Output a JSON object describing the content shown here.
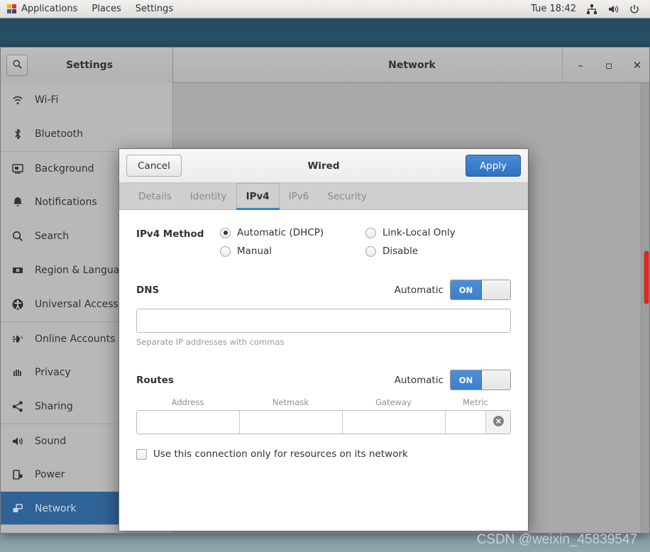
{
  "top_panel": {
    "applications_label": "Applications",
    "places_label": "Places",
    "settings_label": "Settings",
    "apps_icon": "applications-icon",
    "clock": "Tue 18:42",
    "network_icon": "network-wired-icon",
    "volume_icon": "volume-icon",
    "power_icon": "power-icon"
  },
  "window": {
    "settings_title": "Settings",
    "title": "Network",
    "search_icon": "search-icon",
    "minimize_label": "–",
    "maximize_label": "▫",
    "close_label": "✕"
  },
  "sidebar": {
    "items": [
      {
        "label": "Wi-Fi",
        "icon": "wifi-icon"
      },
      {
        "label": "Bluetooth",
        "icon": "bluetooth-icon"
      },
      {
        "label": "Background",
        "icon": "background-monitor-icon"
      },
      {
        "label": "Notifications",
        "icon": "bell-icon"
      },
      {
        "label": "Search",
        "icon": "search-icon"
      },
      {
        "label": "Region & Language",
        "icon": "region-language-icon"
      },
      {
        "label": "Universal Access",
        "icon": "universal-access-icon"
      },
      {
        "label": "Online Accounts",
        "icon": "online-accounts-icon"
      },
      {
        "label": "Privacy",
        "icon": "privacy-icon"
      },
      {
        "label": "Sharing",
        "icon": "sharing-icon"
      },
      {
        "label": "Sound",
        "icon": "sound-icon"
      },
      {
        "label": "Power",
        "icon": "power-battery-icon"
      },
      {
        "label": "Network",
        "icon": "network-icon"
      }
    ],
    "active_label": "Network"
  },
  "main_pane": {
    "add_button_label": "+",
    "gear_icon": "gear-icon",
    "scrollbar_color": "#e8231f"
  },
  "dialog": {
    "cancel_label": "Cancel",
    "title": "Wired",
    "apply_label": "Apply",
    "tabs": [
      {
        "label": "Details",
        "active": false
      },
      {
        "label": "Identity",
        "active": false
      },
      {
        "label": "IPv4",
        "active": true
      },
      {
        "label": "IPv6",
        "active": false
      },
      {
        "label": "Security",
        "active": false
      }
    ],
    "method": {
      "label": "IPv4 Method",
      "options": [
        {
          "label": "Automatic (DHCP)",
          "checked": true
        },
        {
          "label": "Link-Local Only",
          "checked": false
        },
        {
          "label": "Manual",
          "checked": false
        },
        {
          "label": "Disable",
          "checked": false
        }
      ]
    },
    "dns": {
      "label": "DNS",
      "automatic_label": "Automatic",
      "switch_state": "ON",
      "value": "",
      "hint": "Separate IP addresses with commas"
    },
    "routes": {
      "label": "Routes",
      "automatic_label": "Automatic",
      "switch_state": "ON",
      "columns": [
        "Address",
        "Netmask",
        "Gateway",
        "Metric"
      ],
      "rows": [
        {
          "address": "",
          "netmask": "",
          "gateway": "",
          "metric": ""
        }
      ],
      "delete_icon": "remove-circle-icon"
    },
    "restrict_checkbox": {
      "label": "Use this connection only for resources on its network",
      "checked": false
    }
  },
  "watermark": "CSDN @weixin_45839547",
  "colors": {
    "accent_blue": "#3584d8",
    "selection_blue": "#2f6397",
    "apply_blue": "#2f72c4",
    "scrollbar_red": "#e8231f"
  }
}
